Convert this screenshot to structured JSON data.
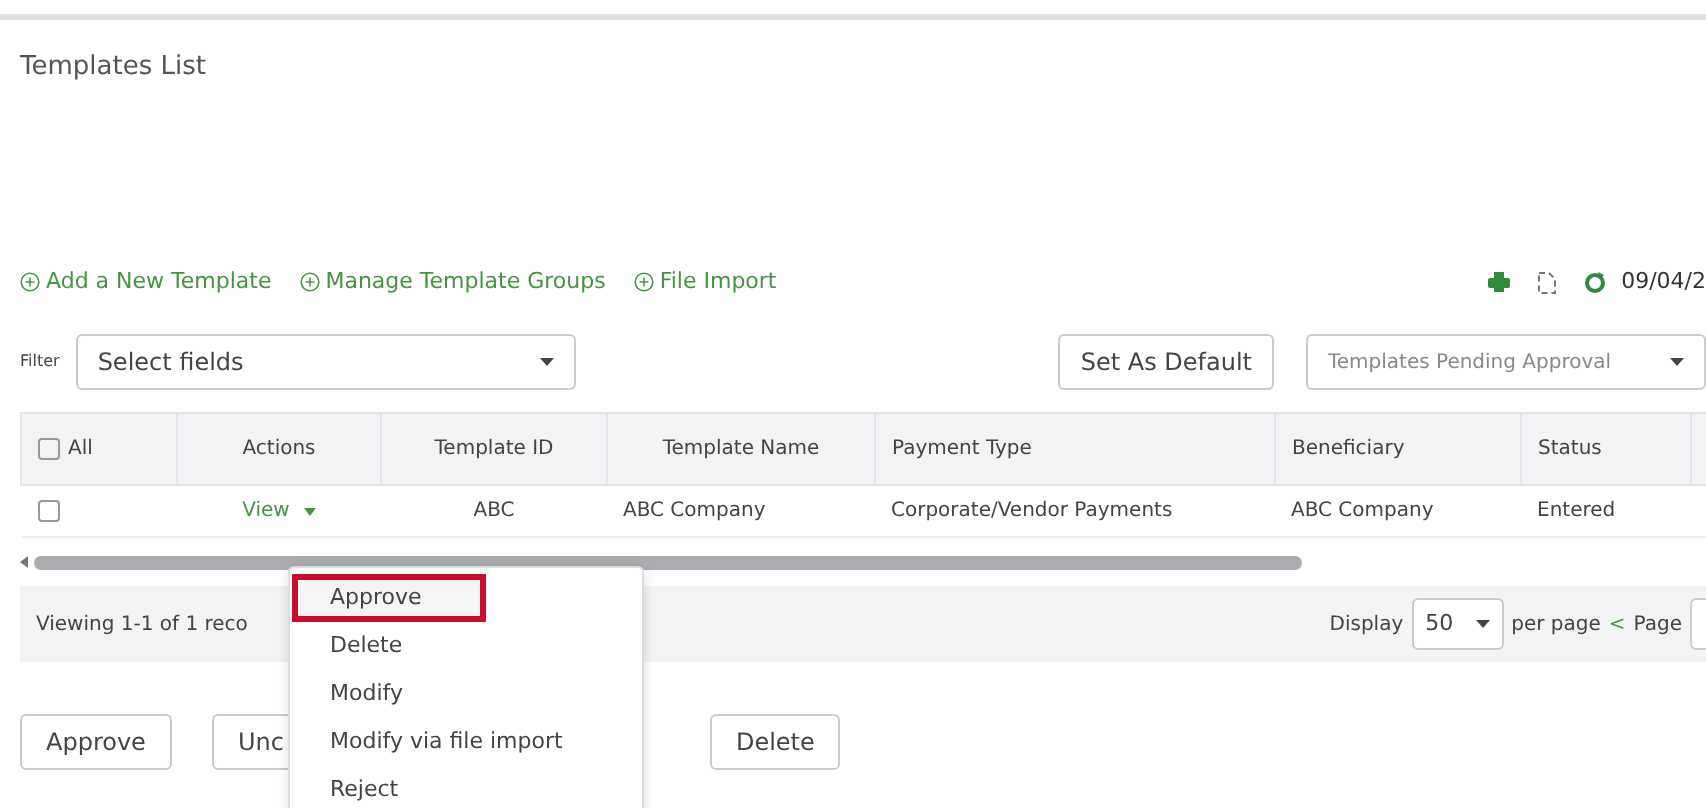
{
  "page_title": "Templates List",
  "links": [
    {
      "label": "Add a New Template"
    },
    {
      "label": "Manage Template Groups"
    },
    {
      "label": "File Import"
    }
  ],
  "toolbar": {
    "date": "09/04/2"
  },
  "filter": {
    "label": "Filter",
    "placeholder": "Select fields",
    "set_default": "Set As Default",
    "view": "Templates Pending Approval"
  },
  "table": {
    "columns": [
      {
        "kind": "checkbox",
        "label": "All",
        "checked": false
      },
      {
        "label": "Actions"
      },
      {
        "label": "Template ID"
      },
      {
        "label": "Template Name"
      },
      {
        "label": "Payment Type"
      },
      {
        "label": "Beneficiary"
      },
      {
        "label": "Status"
      }
    ],
    "rows": [
      {
        "cells": [
          {
            "kind": "checkbox",
            "checked": false
          },
          {
            "kind": "link",
            "text": "View"
          },
          {
            "text": "ABC"
          },
          {
            "text": "ABC Company"
          },
          {
            "text": "Corporate/Vendor Payments"
          },
          {
            "text": "ABC Company"
          },
          {
            "text": "Entered"
          }
        ]
      }
    ]
  },
  "footer": {
    "viewing": "Viewing 1-1 of 1 reco",
    "display": "Display",
    "per_page_value": "50",
    "per_page": "per page",
    "prev": "<",
    "page": "Page"
  },
  "buttons": [
    "Approve",
    "Unc",
    "Delete"
  ],
  "action_menu": [
    {
      "label": "Approve",
      "highlighted": true
    },
    {
      "label": "Delete",
      "highlighted": false
    },
    {
      "label": "Modify",
      "highlighted": false
    },
    {
      "label": "Modify via file import",
      "highlighted": false
    },
    {
      "label": "Reject",
      "highlighted": false
    }
  ]
}
